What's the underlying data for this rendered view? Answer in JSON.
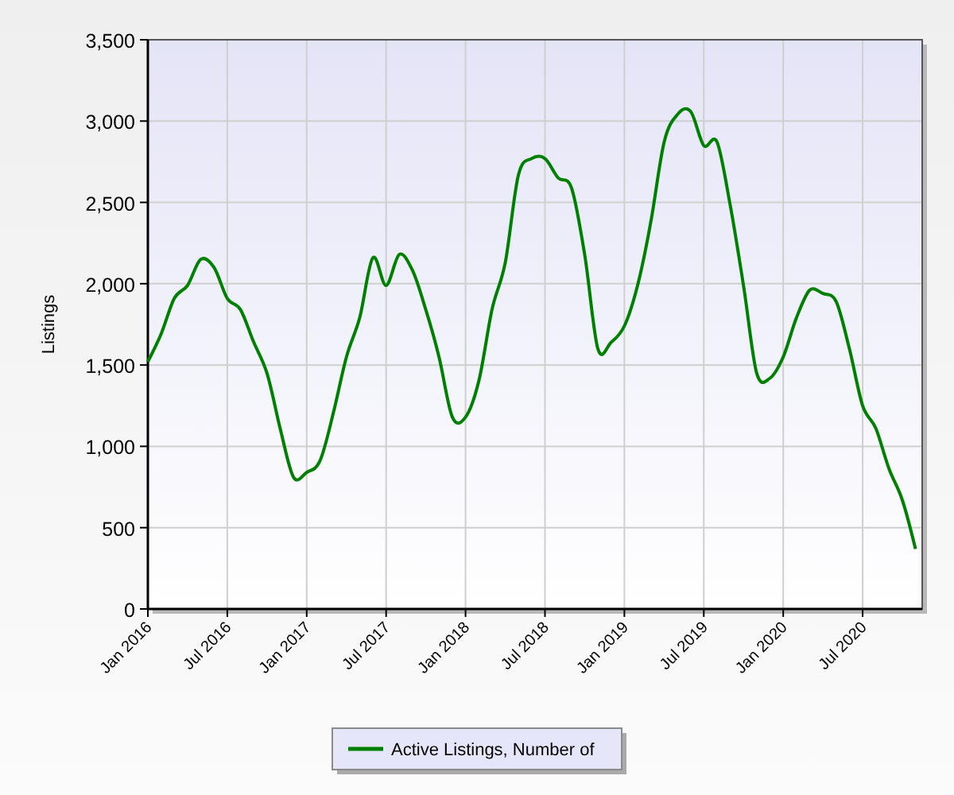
{
  "chart": {
    "chart_data": {
      "type": "line",
      "ylabel": "Listings",
      "categories": [
        "Jan 2016",
        null,
        null,
        null,
        null,
        null,
        "Jul 2016",
        null,
        null,
        null,
        null,
        null,
        "Jan 2017",
        null,
        null,
        null,
        null,
        null,
        "Jul 2017",
        null,
        null,
        null,
        null,
        null,
        "Jan 2018",
        null,
        null,
        null,
        null,
        null,
        "Jul 2018",
        null,
        null,
        null,
        null,
        null,
        "Jan 2019",
        null,
        null,
        null,
        null,
        null,
        "Jul 2019",
        null,
        null,
        null,
        null,
        null,
        "Jan 2020",
        null,
        null,
        null,
        null,
        null,
        "Jul 2020",
        null,
        null,
        null,
        null
      ],
      "series": [
        {
          "name": "Active Listings, Number of",
          "color": "#008000",
          "values": [
            1520,
            1690,
            1910,
            1990,
            2150,
            2100,
            1910,
            1840,
            1640,
            1450,
            1110,
            810,
            840,
            910,
            1200,
            1550,
            1790,
            2160,
            1990,
            2180,
            2080,
            1840,
            1550,
            1180,
            1180,
            1400,
            1840,
            2130,
            2670,
            2770,
            2770,
            2650,
            2590,
            2180,
            1600,
            1640,
            1740,
            1990,
            2380,
            2870,
            3040,
            3060,
            2850,
            2870,
            2480,
            1990,
            1450,
            1420,
            1550,
            1790,
            1960,
            1940,
            1890,
            1600,
            1250,
            1110,
            860,
            670,
            370
          ]
        }
      ],
      "ylim": [
        0,
        3500
      ],
      "grid": true,
      "yticks": [
        {
          "value": 0,
          "label": "0"
        },
        {
          "value": 500,
          "label": "500"
        },
        {
          "value": 1000,
          "label": "1,000"
        },
        {
          "value": 1500,
          "label": "1,500"
        },
        {
          "value": 2000,
          "label": "2,000"
        },
        {
          "value": 2500,
          "label": "2,500"
        },
        {
          "value": 3000,
          "label": "3,000"
        },
        {
          "value": 3500,
          "label": "3,500"
        }
      ]
    }
  }
}
